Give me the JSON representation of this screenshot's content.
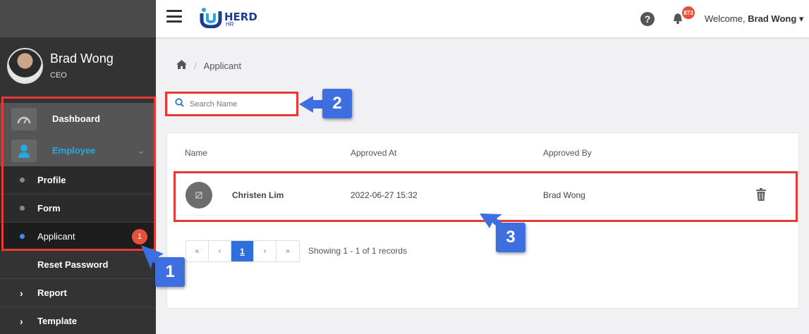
{
  "user": {
    "name": "Brad Wong",
    "role": "CEO"
  },
  "nav": {
    "dashboard": "Dashboard",
    "employee": "Employee",
    "submenu": [
      {
        "label": "Profile"
      },
      {
        "label": "Form"
      },
      {
        "label": "Applicant",
        "badge": "1"
      }
    ],
    "reset_password": "Reset Password",
    "report": "Report",
    "template": "Template"
  },
  "topbar": {
    "logo_text": "HERD",
    "logo_sub": "HR",
    "notification_count": "873",
    "welcome_prefix": "Welcome,",
    "welcome_name": "Brad Wong"
  },
  "breadcrumb": {
    "current": "Applicant"
  },
  "search": {
    "placeholder": "Search Name"
  },
  "table": {
    "columns": [
      "Name",
      "Approved At",
      "Approved By"
    ],
    "rows": [
      {
        "name": "Christen Lim",
        "approved_at": "2022-06-27 15:32",
        "approved_by": "Brad Wong"
      }
    ]
  },
  "pagination": {
    "first": "«",
    "prev": "‹",
    "page": "1",
    "next": "›",
    "last": "»",
    "summary": "Showing 1 - 1 of 1 records"
  },
  "annotations": [
    "1",
    "2",
    "3"
  ],
  "colors": {
    "accent": "#3d6fe0",
    "highlight": "#e53935",
    "badge": "#e8503a",
    "active_nav": "#28a8e0"
  }
}
